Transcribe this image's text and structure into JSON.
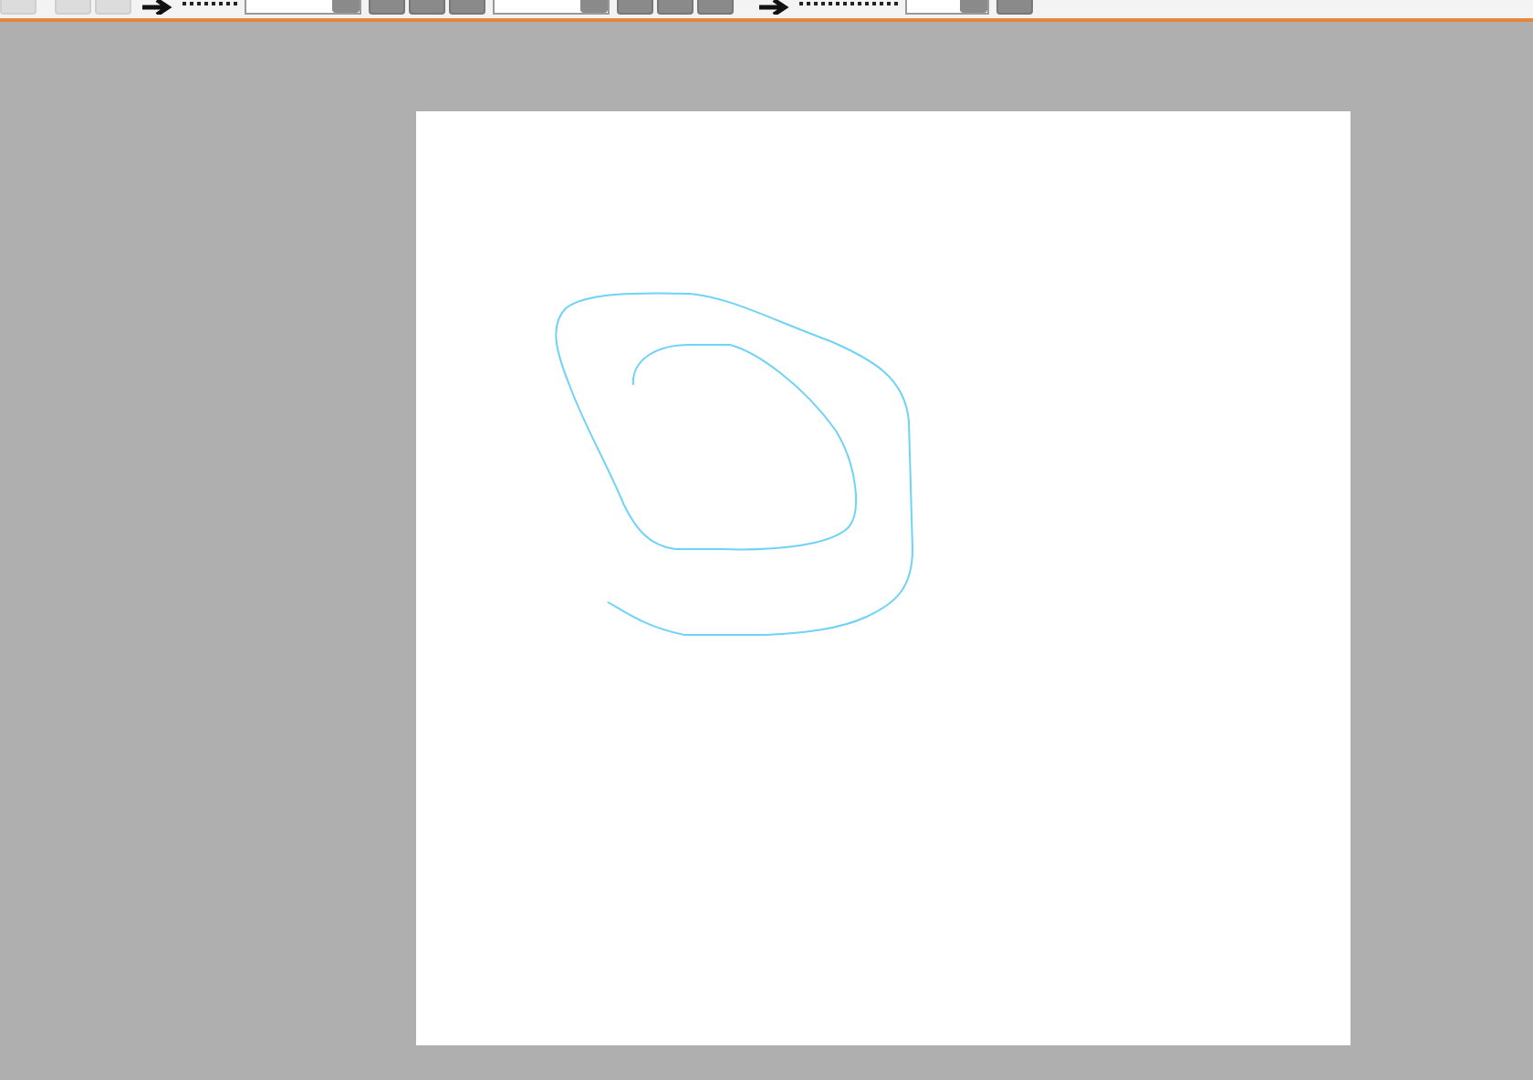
{
  "toolbar": {
    "controls": [
      {
        "kind": "button",
        "disabled": true
      },
      {
        "kind": "gap"
      },
      {
        "kind": "button",
        "disabled": true
      },
      {
        "kind": "button",
        "disabled": true
      },
      {
        "kind": "icon"
      },
      {
        "kind": "label"
      },
      {
        "kind": "field"
      },
      {
        "kind": "button",
        "disabled": false
      },
      {
        "kind": "button",
        "disabled": false
      },
      {
        "kind": "button",
        "disabled": false
      },
      {
        "kind": "field"
      },
      {
        "kind": "button",
        "disabled": false
      },
      {
        "kind": "button",
        "disabled": false
      },
      {
        "kind": "button",
        "disabled": false
      },
      {
        "kind": "gap"
      },
      {
        "kind": "icon"
      },
      {
        "kind": "wide-label"
      },
      {
        "kind": "small-field"
      },
      {
        "kind": "button",
        "disabled": false
      }
    ]
  }
}
